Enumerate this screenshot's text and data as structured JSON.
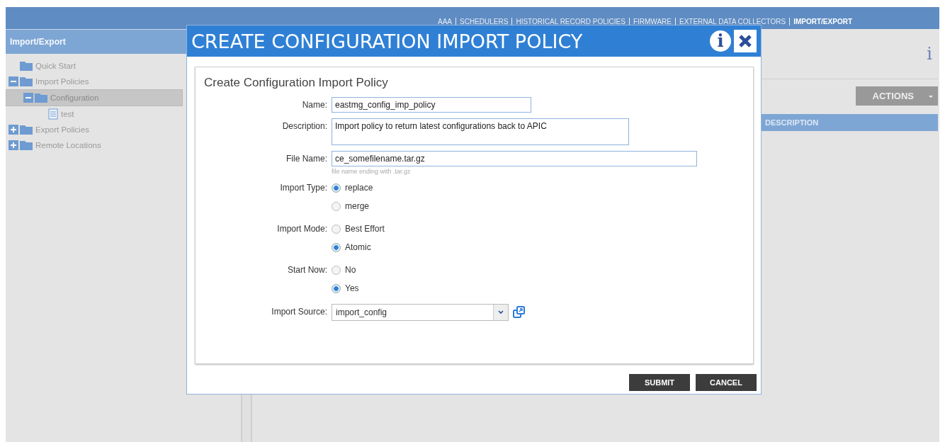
{
  "top_nav": [
    {
      "label": "AAA",
      "selected": false
    },
    {
      "label": "SCHEDULERS",
      "selected": false
    },
    {
      "label": "HISTORICAL RECORD POLICIES",
      "selected": false
    },
    {
      "label": "FIRMWARE",
      "selected": false
    },
    {
      "label": "EXTERNAL DATA COLLECTORS",
      "selected": false
    },
    {
      "label": "IMPORT/EXPORT",
      "selected": true
    }
  ],
  "sidebar": {
    "title": "Import/Export",
    "tree": [
      {
        "label": "Quick Start",
        "kind": "folder",
        "selected": false
      },
      {
        "label": "Import Policies",
        "kind": "folder",
        "expanded": true,
        "selected": false,
        "children": [
          {
            "label": "Configuration",
            "kind": "folder",
            "expanded": true,
            "selected": true,
            "children": [
              {
                "label": "test",
                "kind": "document",
                "selected": false
              }
            ]
          }
        ]
      },
      {
        "label": "Export Policies",
        "kind": "folder",
        "expanded": false,
        "selected": false
      },
      {
        "label": "Remote Locations",
        "kind": "folder",
        "expanded": false,
        "selected": false
      }
    ]
  },
  "main": {
    "info": "i",
    "actions_button": "ACTIONS",
    "table": {
      "columns": [
        "DESCRIPTION"
      ]
    }
  },
  "dialog": {
    "title": "CREATE CONFIGURATION IMPORT POLICY",
    "info": "i",
    "panel_title": "Create Configuration Import Policy",
    "fields": [
      {
        "kind": "text",
        "label": "Name:",
        "value": "eastmg_config_imp_policy"
      },
      {
        "kind": "textarea",
        "label": "Description:",
        "value": "Import policy to return latest configurations back to APIC"
      },
      {
        "kind": "file",
        "label": "File Name:",
        "value": "ce_somefilename.tar.gz",
        "hint": "file name ending with .tar.gz"
      },
      {
        "kind": "radio",
        "label": "Import Type:",
        "options": [
          {
            "label": "replace",
            "selected": true
          },
          {
            "label": "merge",
            "selected": false
          }
        ]
      },
      {
        "kind": "radio",
        "label": "Import Mode:",
        "options": [
          {
            "label": "Best Effort",
            "selected": false
          },
          {
            "label": "Atomic",
            "selected": true
          }
        ]
      },
      {
        "kind": "radio",
        "label": "Start Now:",
        "options": [
          {
            "label": "No",
            "selected": false
          },
          {
            "label": "Yes",
            "selected": true
          }
        ]
      },
      {
        "kind": "select",
        "label": "Import Source:",
        "value": "import_config"
      }
    ],
    "buttons": [
      "SUBMIT",
      "CANCEL"
    ]
  }
}
